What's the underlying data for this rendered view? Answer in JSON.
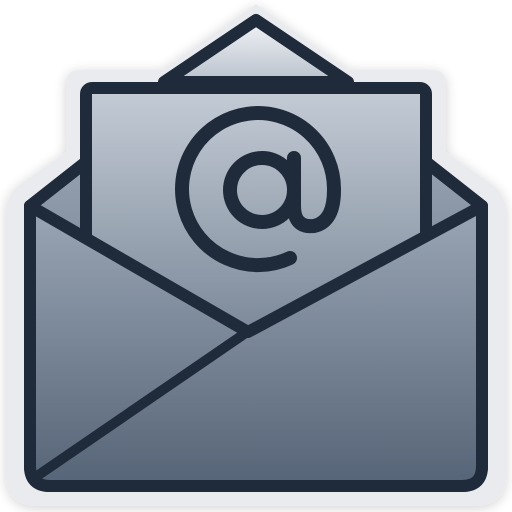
{
  "icon": {
    "name": "open-envelope-email-icon",
    "glyph": "@",
    "colors": {
      "outline": "#1f2a3a",
      "halo": "#e9ebee",
      "envelope_top": "#9aa6b5",
      "envelope_bottom": "#566477",
      "letter_top": "#c4ccd6",
      "letter_bottom": "#6c7a8c",
      "flap_top": "#f2f4f7",
      "flap_bottom": "#b9c1cc"
    }
  }
}
